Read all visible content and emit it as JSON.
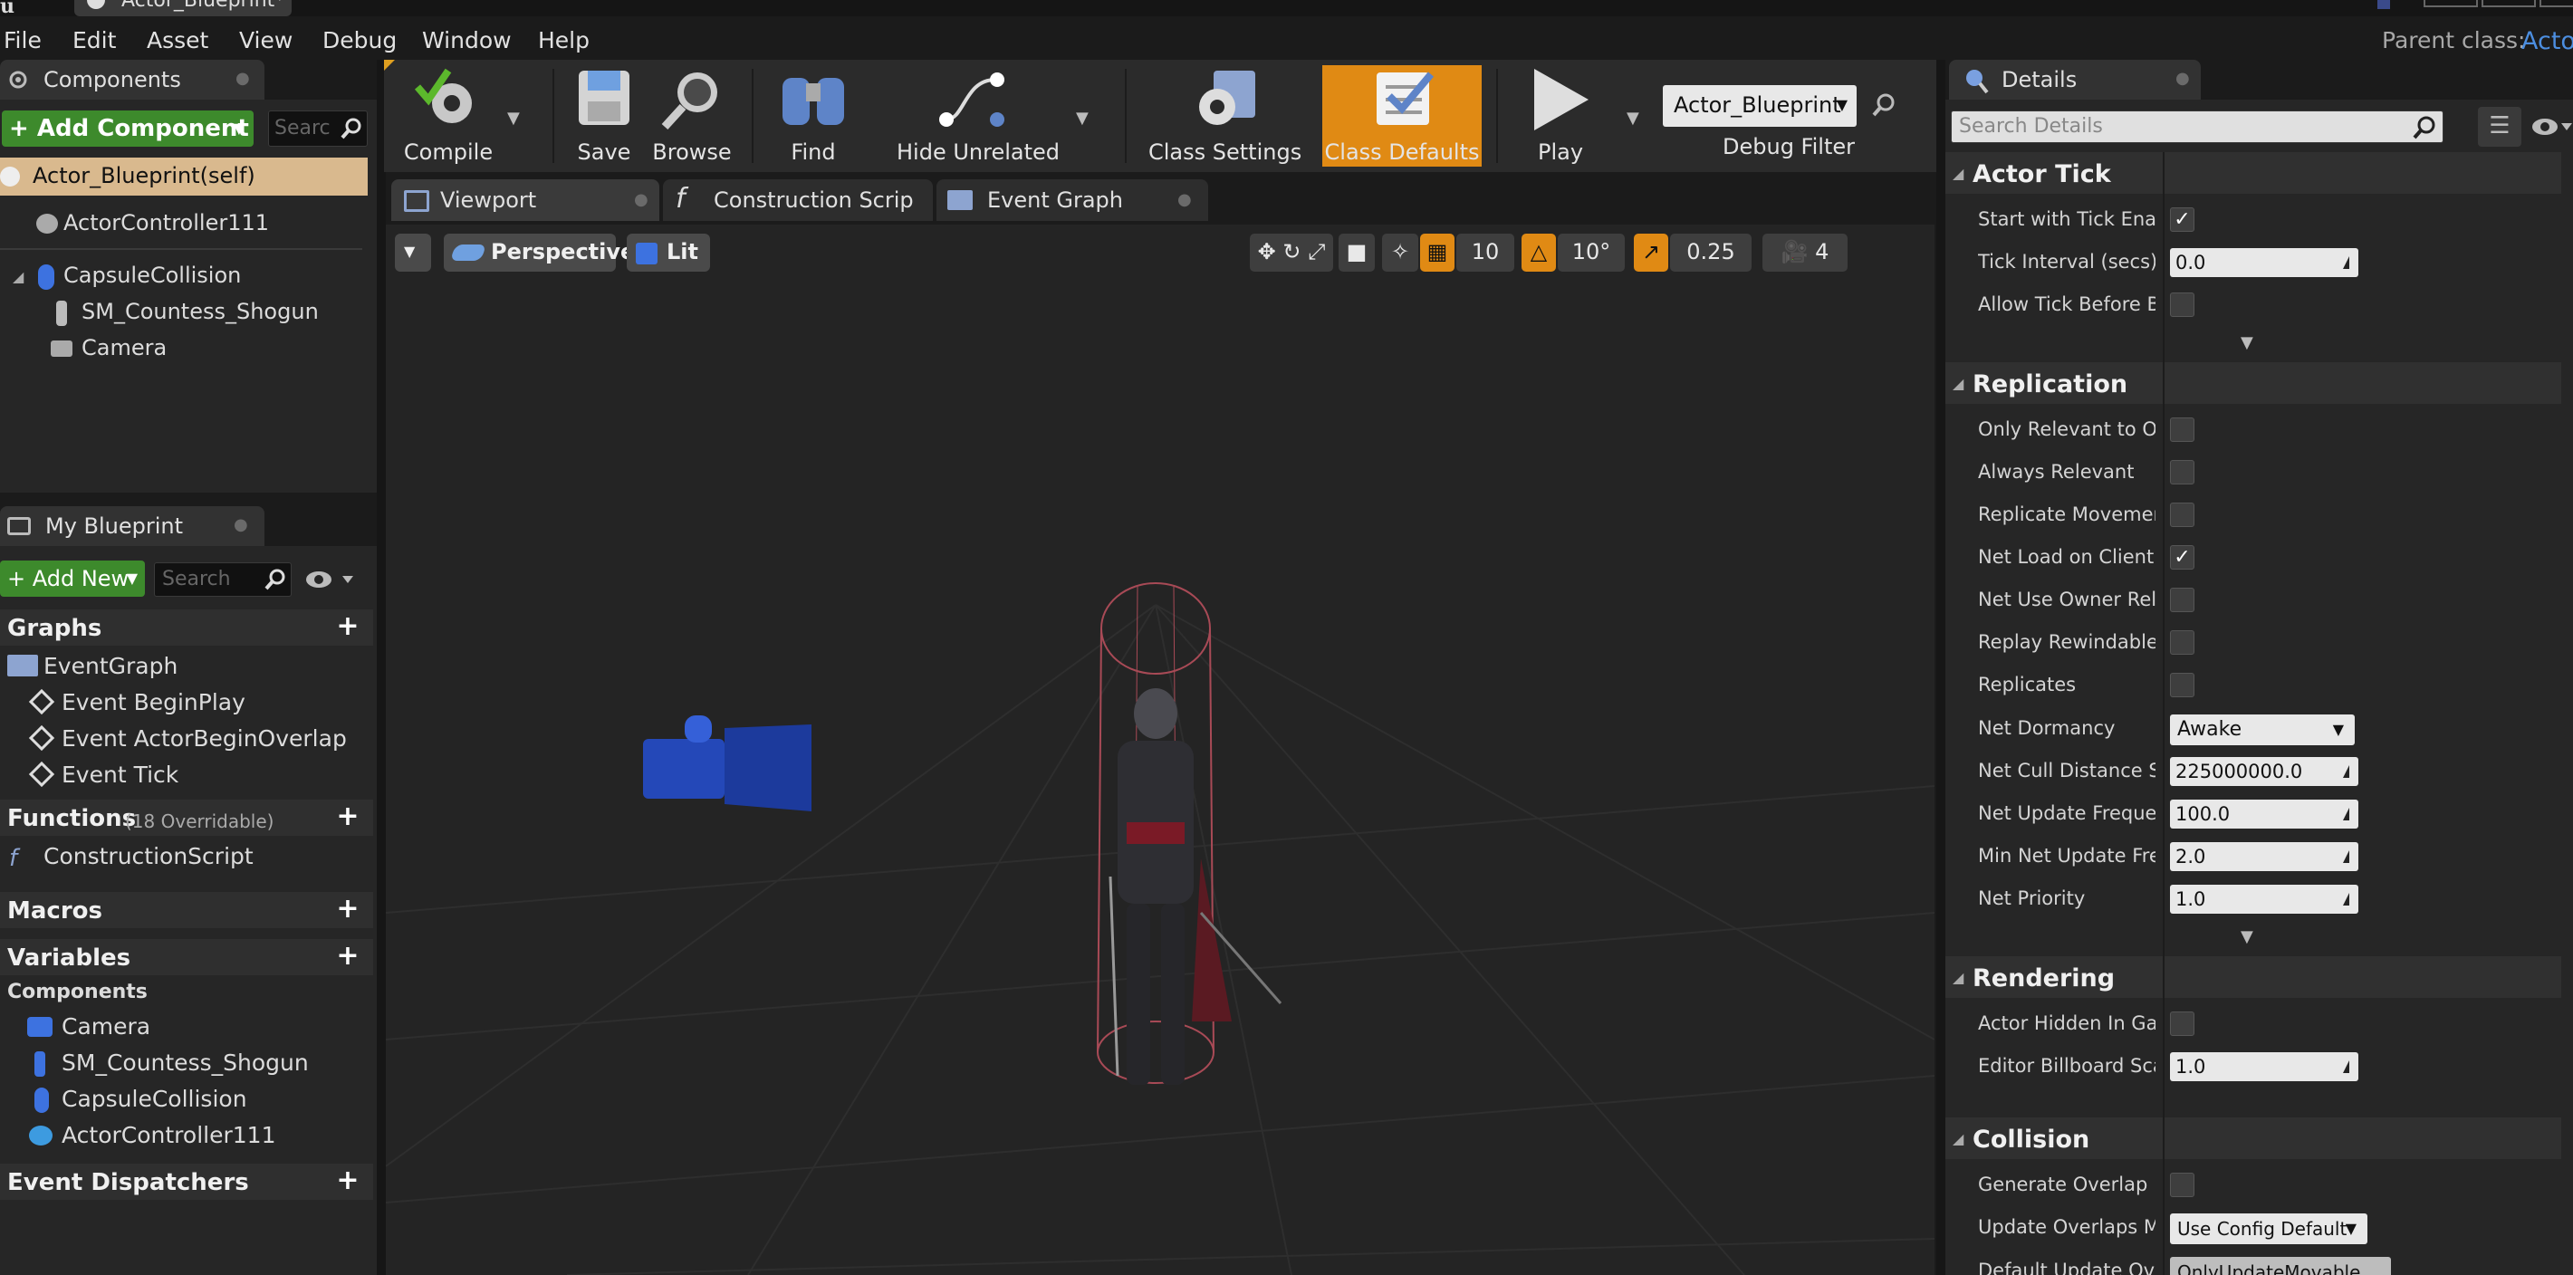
{
  "window": {
    "tab_title": "Actor_Blueprint*",
    "logo": "u"
  },
  "menu": {
    "items": [
      "File",
      "Edit",
      "Asset",
      "View",
      "Debug",
      "Window",
      "Help"
    ],
    "parent_class_label": "Parent class:",
    "parent_class_value": "Acto"
  },
  "components_panel": {
    "tab_label": "Components",
    "add_component_label": "+ Add Component",
    "search_placeholder": "Searc",
    "items": [
      {
        "label": "Actor_Blueprint(self)",
        "icon": "blueprint-self-icon"
      },
      {
        "label": "ActorController111",
        "icon": "controller-component-icon"
      },
      {
        "label": "CapsuleCollision",
        "icon": "capsule-icon"
      },
      {
        "label": "SM_Countess_Shogun",
        "icon": "skeletal-mesh-icon"
      },
      {
        "label": "Camera",
        "icon": "camera-icon"
      }
    ]
  },
  "my_blueprint": {
    "tab_label": "My Blueprint",
    "add_new_label": "+ Add New",
    "search_placeholder": "Search",
    "graphs_label": "Graphs",
    "event_graph_label": "EventGraph",
    "events": [
      "Event BeginPlay",
      "Event ActorBeginOverlap",
      "Event Tick"
    ],
    "functions_label": "Functions",
    "functions_note": "(18 Overridable)",
    "construction_script_label": "ConstructionScript",
    "macros_label": "Macros",
    "variables_label": "Variables",
    "components_label": "Components",
    "component_vars": [
      "Camera",
      "SM_Countess_Shogun",
      "CapsuleCollision",
      "ActorController111"
    ],
    "event_dispatchers_label": "Event Dispatchers"
  },
  "toolbar": {
    "compile": "Compile",
    "save": "Save",
    "browse": "Browse",
    "find": "Find",
    "hide_unrelated": "Hide Unrelated",
    "class_settings": "Class Settings",
    "class_defaults": "Class Defaults",
    "play": "Play",
    "debug_object": "Actor_Blueprint",
    "debug_filter": "Debug Filter",
    "accent": "#e08a14"
  },
  "editor_tabs": [
    "Viewport",
    "Construction Scrip",
    "Event Graph"
  ],
  "viewport": {
    "perspective": "Perspective",
    "lit": "Lit",
    "grid_snap": "10",
    "rotation_snap": "10°",
    "scale_snap": "0.25",
    "camera_speed": "4"
  },
  "details": {
    "tab_label": "Details",
    "search_placeholder": "Search Details",
    "categories": {
      "actor_tick": {
        "label": "Actor Tick",
        "start_with_tick": "Start with Tick Enabled",
        "tick_interval": "Tick Interval (secs)",
        "tick_interval_value": "0.0",
        "allow_tick_before_begin": "Allow Tick Before Begin Play"
      },
      "replication": {
        "label": "Replication",
        "only_relevant_owner": "Only Relevant to Owner",
        "always_relevant": "Always Relevant",
        "replicate_movement": "Replicate Movement",
        "net_load_on_client": "Net Load on Client",
        "net_use_owner_relevancy": "Net Use Owner Relevancy",
        "replay_rewindable": "Replay Rewindable",
        "replicates": "Replicates",
        "net_dormancy": "Net Dormancy",
        "net_dormancy_value": "Awake",
        "net_cull_distance": "Net Cull Distance Squared",
        "net_cull_distance_value": "225000000.0",
        "net_update_frequency": "Net Update Frequency",
        "net_update_frequency_value": "100.0",
        "min_net_update": "Min Net Update Frequency",
        "min_net_update_value": "2.0",
        "net_priority": "Net Priority",
        "net_priority_value": "1.0"
      },
      "rendering": {
        "label": "Rendering",
        "actor_hidden": "Actor Hidden In Game",
        "billboard_scale": "Editor Billboard Scale",
        "billboard_scale_value": "1.0"
      },
      "collision": {
        "label": "Collision",
        "generate_overlap": "Generate Overlap Events",
        "update_overlaps": "Update Overlaps Method",
        "update_overlaps_value": "Use Config Default",
        "default_update_overlaps": "Default Update Overlaps Method",
        "default_update_overlaps_value": "OnlyUpdateMovable"
      }
    }
  }
}
